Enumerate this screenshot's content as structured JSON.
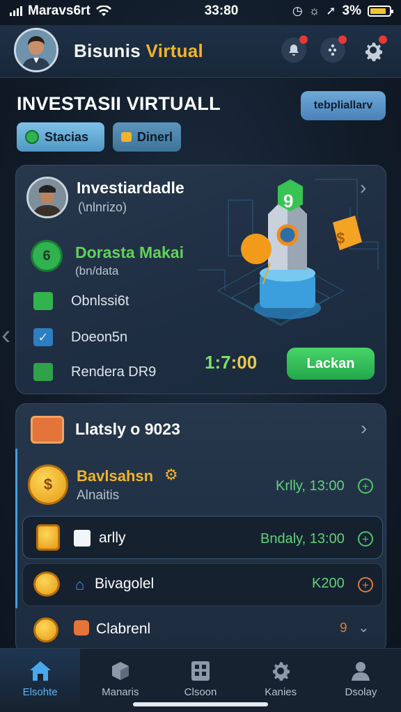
{
  "status_bar": {
    "carrier": "Maravs6rt",
    "time": "33:80",
    "battery_text": "3%",
    "battery_level": 0.85
  },
  "header": {
    "title_part1": "Bisunis ",
    "title_part2": "Virtual",
    "icons": [
      "bell-icon",
      "chat-icon",
      "gear-icon"
    ]
  },
  "section": {
    "title": "INVESTASII VIRTUALL",
    "action_button": "tebpliallarv",
    "chips": [
      {
        "label": "Stacias",
        "icon": "coin-icon"
      },
      {
        "label": "Dinerl",
        "icon": "wallet-icon"
      }
    ]
  },
  "main_card": {
    "title": "Investiardadle",
    "subtitle": "(\\nlnrizo)",
    "badge_title": "Dorasta Makai",
    "badge_sub": "(bn/data",
    "badge_glyph": "6",
    "items": [
      {
        "label": "Obnlssi6t",
        "icon": "cube-icon",
        "marker": "❖"
      },
      {
        "label": "Doeon5n",
        "icon": "check-icon",
        "marker": "✔"
      },
      {
        "label": "Rendera DR9",
        "icon": "money-icon",
        "marker": ""
      }
    ],
    "timer_a": "1:7",
    "timer_b": ":00",
    "cta": "Lackan",
    "rocket_label": "9"
  },
  "list_card": {
    "title": "Llatsly o 9023",
    "entries": [
      {
        "title": "Bavlsahsn",
        "subtitle": "Alnaitis",
        "amount": "Krlly, 13:00"
      },
      {
        "title": "arlly",
        "amount": "Bndaly, 13:00"
      },
      {
        "title": "Bivagolel",
        "amount": "K200"
      },
      {
        "title": "Clabrenl",
        "amount": "9"
      }
    ]
  },
  "bottom_nav": [
    {
      "label": "Elsohte",
      "icon": "home-icon"
    },
    {
      "label": "Manaris",
      "icon": "cube-icon"
    },
    {
      "label": "Clsoon",
      "icon": "grid-icon"
    },
    {
      "label": "Kanies",
      "icon": "gear-icon"
    },
    {
      "label": "Dsolay",
      "icon": "user-icon"
    }
  ],
  "colors": {
    "accent_gold": "#f2b42a",
    "accent_green": "#3cc45e",
    "accent_blue": "#5fb3ee",
    "background": "#111b28"
  }
}
